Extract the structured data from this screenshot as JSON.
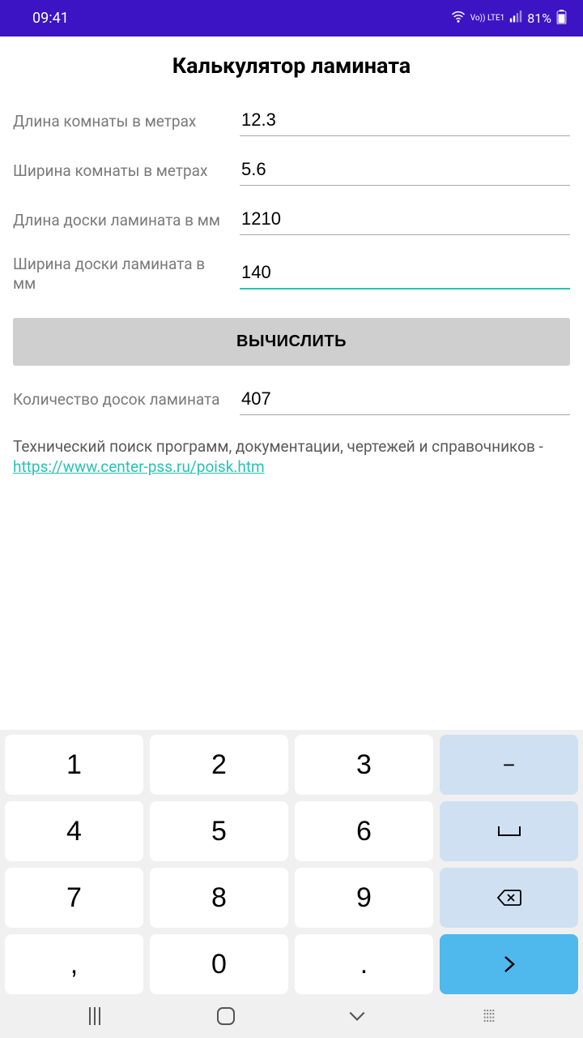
{
  "status": {
    "time": "09:41",
    "network_label": "Vo)) LTE1",
    "battery": "81%"
  },
  "title": "Калькулятор ламината",
  "fields": {
    "room_length": {
      "label": "Длина комнаты в метрах",
      "value": "12.3"
    },
    "room_width": {
      "label": "Ширина комнаты в метрах",
      "value": "5.6"
    },
    "board_length": {
      "label": "Длина доски ламината в мм",
      "value": "1210"
    },
    "board_width": {
      "label": "Ширина доски ламината в мм",
      "value": "140"
    },
    "result": {
      "label": "Количество досок ламината",
      "value": "407"
    }
  },
  "button": {
    "calculate": "ВЫЧИСЛИТЬ"
  },
  "footer": {
    "text": "Технический поиск программ, документации, чертежей и справочников - ",
    "link": "https://www.center-pss.ru/poisk.htm"
  },
  "keyboard": {
    "keys": [
      [
        "1",
        "2",
        "3",
        "−"
      ],
      [
        "4",
        "5",
        "6",
        "space"
      ],
      [
        "7",
        "8",
        "9",
        "backspace"
      ],
      [
        ",",
        "0",
        ".",
        "enter"
      ]
    ]
  }
}
